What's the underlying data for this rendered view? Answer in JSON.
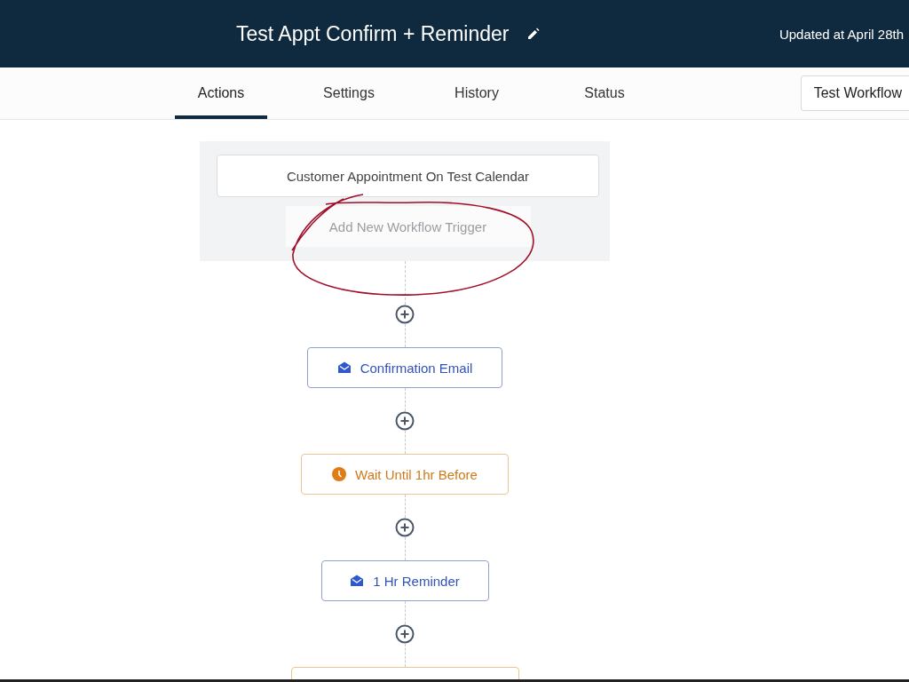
{
  "header": {
    "title": "Test Appt Confirm + Reminder",
    "updated": "Updated at April 28th"
  },
  "tabs": [
    {
      "label": "Actions",
      "selected": true
    },
    {
      "label": "Settings",
      "selected": false
    },
    {
      "label": "History",
      "selected": false
    },
    {
      "label": "Status",
      "selected": false
    }
  ],
  "test_button": "Test Workflow",
  "triggers": [
    {
      "kind": "trigger",
      "label": "Customer Appointment On Test Calendar"
    },
    {
      "kind": "add",
      "label": "Add New Workflow Trigger"
    }
  ],
  "actions": [
    {
      "kind": "email",
      "label": "Confirmation Email"
    },
    {
      "kind": "wait",
      "label": "Wait Until 1hr Before"
    },
    {
      "kind": "email",
      "label": "1 Hr Reminder"
    },
    {
      "kind": "wait"
    }
  ]
}
